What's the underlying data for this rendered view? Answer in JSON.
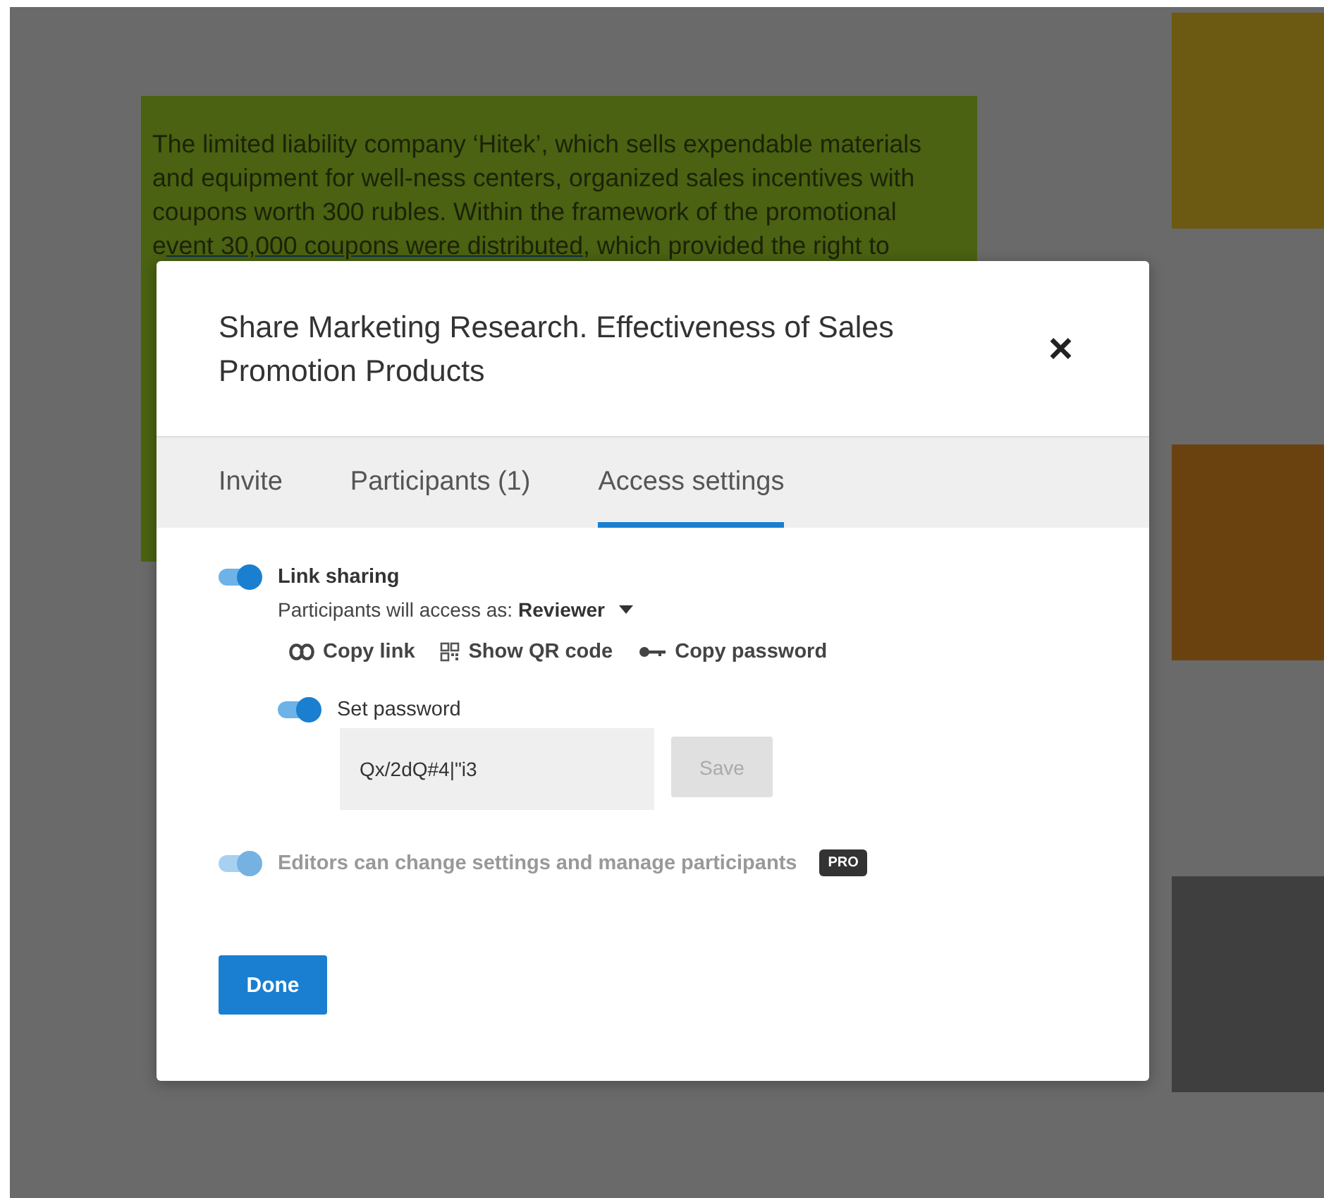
{
  "board": {
    "note": {
      "lines": [
        [
          {
            "text": "The limited liability company ‘Hitek’, which sells expendable materials",
            "underlined": false
          }
        ],
        [
          {
            "text": "and equipment for well-ness centers, organized sales incentives with",
            "underlined": false
          }
        ],
        [
          {
            "text": "coupons worth 300 rubles. Within the framework of the promotional",
            "underlined": false
          }
        ],
        [
          {
            "text": "e",
            "underlined": false
          },
          {
            "text": "vent 30,000 coupons were distributed,",
            "underlined": true
          },
          {
            "text": " which provided the right to",
            "underlined": false
          }
        ]
      ]
    }
  },
  "dialog": {
    "title": "Share Marketing Research. Effectiveness of Sales Promotion Products",
    "close": "×",
    "tabs": [
      {
        "label": "Invite",
        "selected": false
      },
      {
        "label": "Participants (1)",
        "selected": false
      },
      {
        "label": "Access settings",
        "selected": true
      }
    ],
    "link_sharing": {
      "on": true,
      "label": "Link sharing",
      "access_prefix": "Participants will access as:",
      "access_role": "Reviewer",
      "actions": [
        {
          "kind": "link",
          "label": "Copy link"
        },
        {
          "kind": "qr",
          "label": "Show QR code"
        },
        {
          "kind": "key",
          "label": "Copy password"
        }
      ]
    },
    "password": {
      "on": true,
      "label": "Set password",
      "value": "Qx/2dQ#4|\"i3",
      "save": "Save",
      "save_disabled": true
    },
    "editors": {
      "on": true,
      "disabled": true,
      "label": "Editors can change settings and manage participants",
      "badge": "PRO"
    },
    "done": "Done"
  }
}
